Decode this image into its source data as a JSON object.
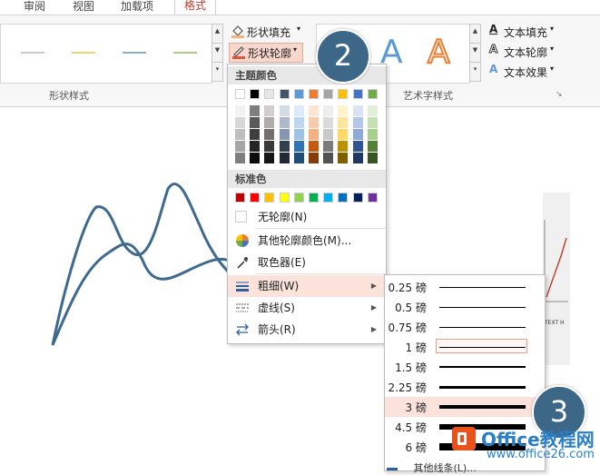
{
  "tabs": [
    {
      "label": "审阅",
      "active": false
    },
    {
      "label": "视图",
      "active": false
    },
    {
      "label": "加载项",
      "active": false
    },
    {
      "label": "格式",
      "active": true
    }
  ],
  "ribbon": {
    "shape_styles_label": "形状样式",
    "art_styles_label": "艺术字样式",
    "shape_fill_label": "形状填充",
    "shape_outline_label": "形状轮廓",
    "text_fill_label": "文本填充",
    "text_outline_label": "文本轮廓",
    "text_effect_label": "文本效果",
    "gallery_line_colors": [
      "#c9c9c9",
      "#f1d36e",
      "#8ea9cf",
      "#a7cd86"
    ],
    "art_letter": "A"
  },
  "menu": {
    "theme_colors_header": "主题颜色",
    "theme_colors_top": [
      "#ffffff",
      "#000000",
      "#e7e6e6",
      "#44546a",
      "#5b9bd5",
      "#ed7d31",
      "#a5a5a5",
      "#ffc000",
      "#4472c4",
      "#70ad47"
    ],
    "theme_shades": [
      [
        "#f2f2f2",
        "#7f7f7f",
        "#d0cece",
        "#d6dce4",
        "#deebf6",
        "#fbe5d5",
        "#ededed",
        "#fff2cc",
        "#dae3f3",
        "#e2efd9"
      ],
      [
        "#d8d8d8",
        "#595959",
        "#aeabab",
        "#adb9ca",
        "#bdd7ee",
        "#f7cbac",
        "#dbdbdb",
        "#fee599",
        "#b4c6e7",
        "#c5e0b3"
      ],
      [
        "#bfbfbf",
        "#3f3f3f",
        "#757070",
        "#8496b0",
        "#9dc3e6",
        "#f4b183",
        "#c9c9c9",
        "#ffd965",
        "#8eaadb",
        "#a8d08d"
      ],
      [
        "#a5a5a5",
        "#262626",
        "#3a3838",
        "#323f4f",
        "#2e75b5",
        "#c55a11",
        "#7b7b7b",
        "#bf9000",
        "#2f5496",
        "#538135"
      ],
      [
        "#7f7f7f",
        "#0c0c0c",
        "#171616",
        "#222a35",
        "#1e4e79",
        "#833c0b",
        "#525252",
        "#7f6000",
        "#1f3864",
        "#375623"
      ]
    ],
    "standard_colors_header": "标准色",
    "standard_colors": [
      "#c00000",
      "#ff0000",
      "#ffc000",
      "#ffff00",
      "#92d050",
      "#00b050",
      "#00b0f0",
      "#0070c0",
      "#002060",
      "#7030a0"
    ],
    "no_outline": "无轮廓(N)",
    "more_colors": "其他轮廓颜色(M)...",
    "eyedropper": "取色器(E)",
    "weight": "粗细(W)",
    "dashes": "虚线(S)",
    "arrows": "箭头(R)"
  },
  "weights": [
    {
      "label": "0.25 磅",
      "pt": 0.25,
      "selected": false,
      "hover": false
    },
    {
      "label": "0.5 磅",
      "pt": 0.5,
      "selected": false,
      "hover": false
    },
    {
      "label": "0.75 磅",
      "pt": 0.75,
      "selected": false,
      "hover": false
    },
    {
      "label": "1 磅",
      "pt": 1,
      "selected": true,
      "hover": false
    },
    {
      "label": "1.5 磅",
      "pt": 1.5,
      "selected": false,
      "hover": false
    },
    {
      "label": "2.25 磅",
      "pt": 2.25,
      "selected": false,
      "hover": false
    },
    {
      "label": "3 磅",
      "pt": 3,
      "selected": false,
      "hover": true
    },
    {
      "label": "4.5 磅",
      "pt": 4.5,
      "selected": false,
      "hover": false
    },
    {
      "label": "6 磅",
      "pt": 6,
      "selected": false,
      "hover": false
    }
  ],
  "weights_more": "其他线条(L)...",
  "markers": {
    "step2": "2",
    "step3": "3"
  },
  "slide": {
    "curve_color": "#3f6a8f",
    "thumb_text": "TEXT H"
  },
  "watermark": {
    "brand": "Office教程网",
    "url": "www.office26.com"
  }
}
